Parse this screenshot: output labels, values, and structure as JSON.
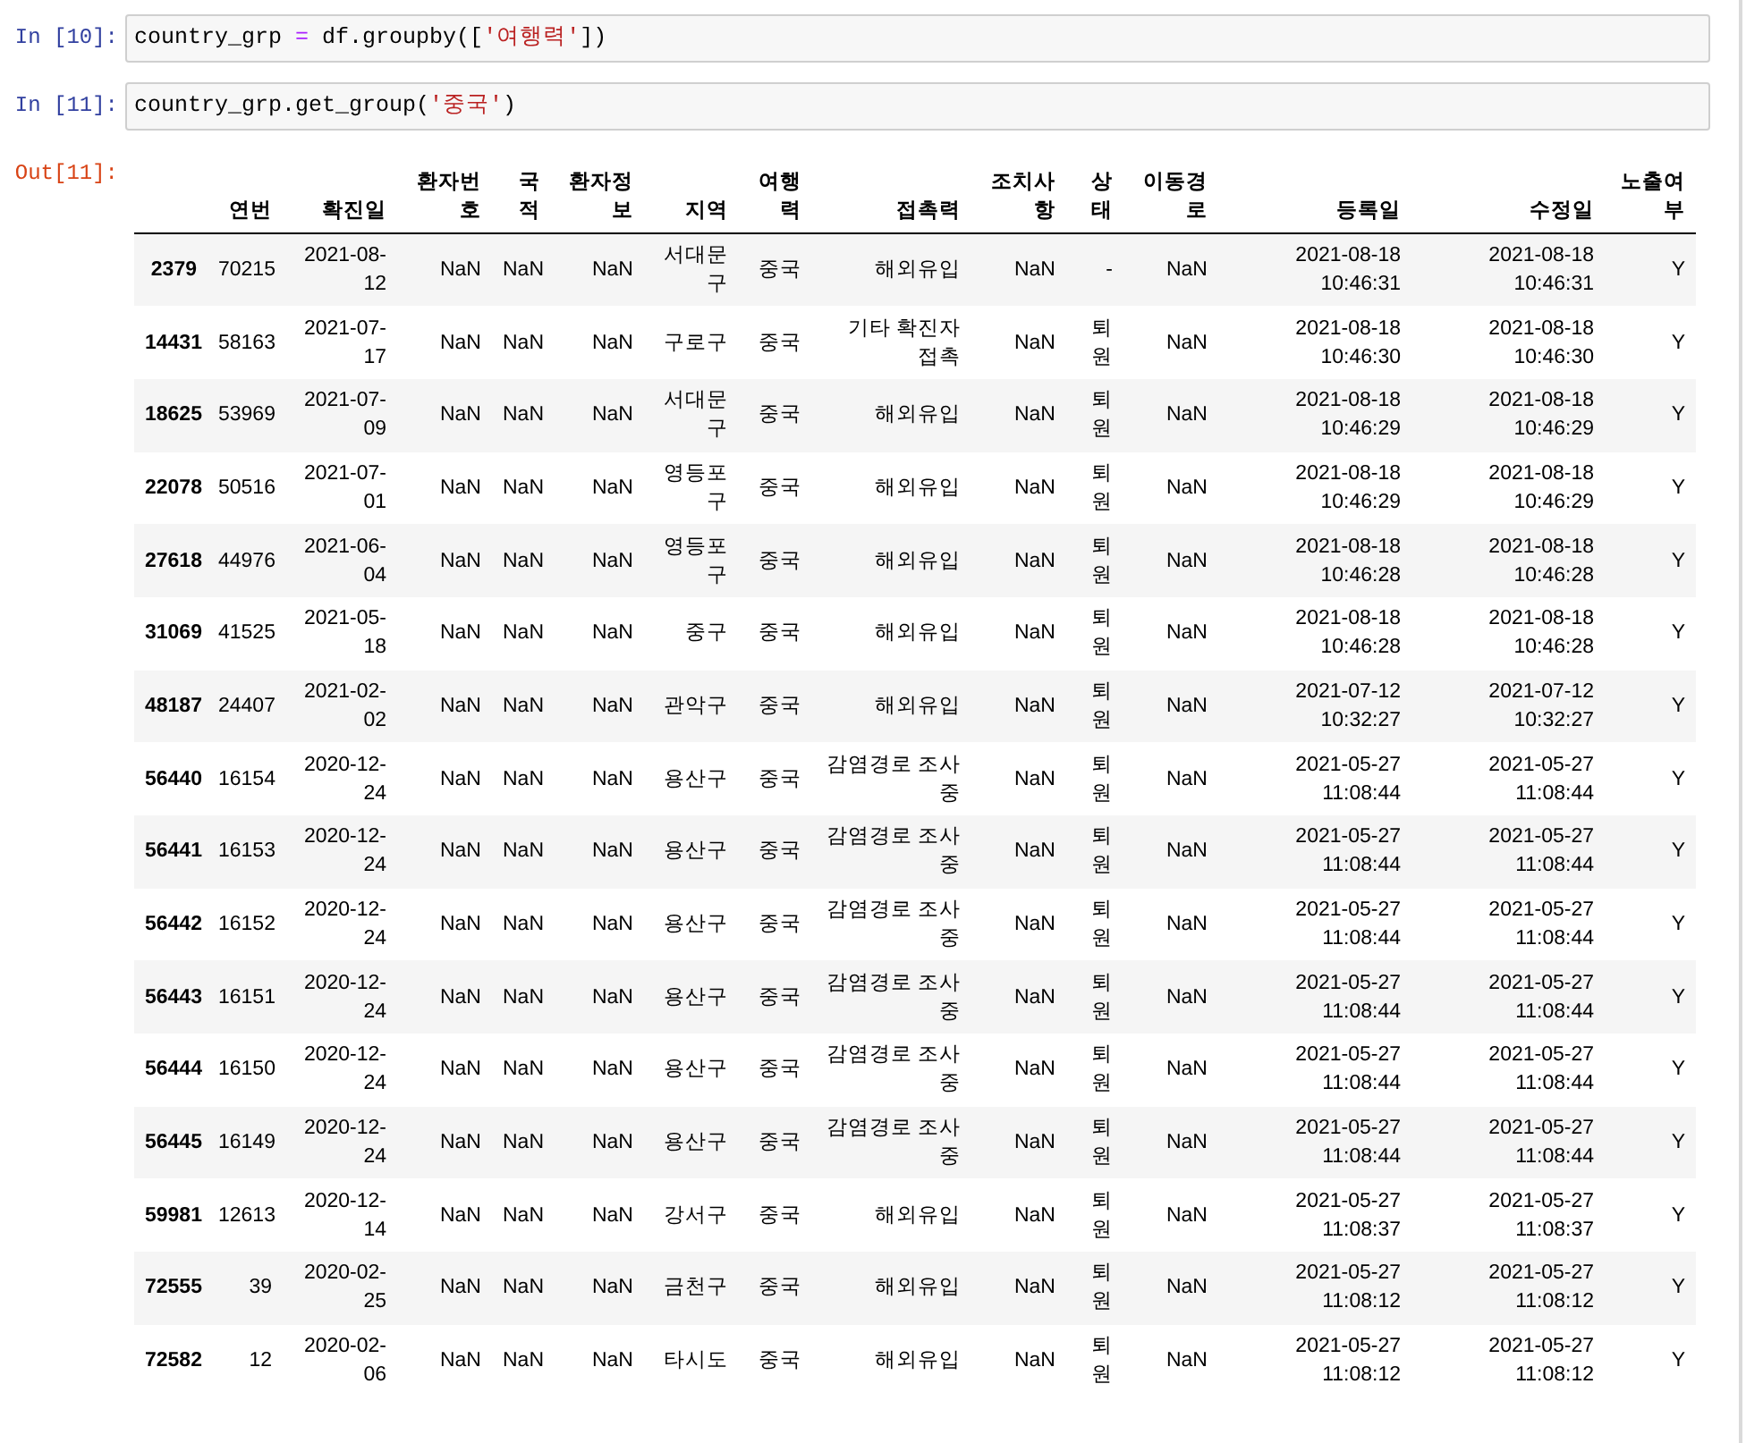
{
  "cells": [
    {
      "prompt": "In [10]:",
      "tokens": [
        {
          "text": "country_grp ",
          "kind": "name"
        },
        {
          "text": "=",
          "kind": "operator"
        },
        {
          "text": " df.groupby([",
          "kind": "name"
        },
        {
          "text": "'여행력'",
          "kind": "string"
        },
        {
          "text": "])",
          "kind": "name"
        }
      ]
    },
    {
      "prompt": "In [11]:",
      "tokens": [
        {
          "text": "country_grp.get_group(",
          "kind": "name"
        },
        {
          "text": "'중국'",
          "kind": "string"
        },
        {
          "text": ")",
          "kind": "name"
        }
      ]
    }
  ],
  "output": {
    "prompt": "Out[11]:",
    "table": {
      "columns": [
        "연번",
        "확진일",
        "환자번호",
        "국적",
        "환자정보",
        "지역",
        "여행력",
        "접촉력",
        "조치사항",
        "상태",
        "이동경로",
        "등록일",
        "수정일",
        "노출여부"
      ],
      "rows": [
        {
          "index": "2379",
          "cells": [
            "70215",
            "2021-08-12",
            "NaN",
            "NaN",
            "NaN",
            "서대문구",
            "중국",
            "해외유입",
            "NaN",
            "-",
            "NaN",
            "2021-08-18 10:46:31",
            "2021-08-18 10:46:31",
            "Y"
          ]
        },
        {
          "index": "14431",
          "cells": [
            "58163",
            "2021-07-17",
            "NaN",
            "NaN",
            "NaN",
            "구로구",
            "중국",
            "기타 확진자 접촉",
            "NaN",
            "퇴원",
            "NaN",
            "2021-08-18 10:46:30",
            "2021-08-18 10:46:30",
            "Y"
          ]
        },
        {
          "index": "18625",
          "cells": [
            "53969",
            "2021-07-09",
            "NaN",
            "NaN",
            "NaN",
            "서대문구",
            "중국",
            "해외유입",
            "NaN",
            "퇴원",
            "NaN",
            "2021-08-18 10:46:29",
            "2021-08-18 10:46:29",
            "Y"
          ]
        },
        {
          "index": "22078",
          "cells": [
            "50516",
            "2021-07-01",
            "NaN",
            "NaN",
            "NaN",
            "영등포구",
            "중국",
            "해외유입",
            "NaN",
            "퇴원",
            "NaN",
            "2021-08-18 10:46:29",
            "2021-08-18 10:46:29",
            "Y"
          ]
        },
        {
          "index": "27618",
          "cells": [
            "44976",
            "2021-06-04",
            "NaN",
            "NaN",
            "NaN",
            "영등포구",
            "중국",
            "해외유입",
            "NaN",
            "퇴원",
            "NaN",
            "2021-08-18 10:46:28",
            "2021-08-18 10:46:28",
            "Y"
          ]
        },
        {
          "index": "31069",
          "cells": [
            "41525",
            "2021-05-18",
            "NaN",
            "NaN",
            "NaN",
            "중구",
            "중국",
            "해외유입",
            "NaN",
            "퇴원",
            "NaN",
            "2021-08-18 10:46:28",
            "2021-08-18 10:46:28",
            "Y"
          ]
        },
        {
          "index": "48187",
          "cells": [
            "24407",
            "2021-02-02",
            "NaN",
            "NaN",
            "NaN",
            "관악구",
            "중국",
            "해외유입",
            "NaN",
            "퇴원",
            "NaN",
            "2021-07-12 10:32:27",
            "2021-07-12 10:32:27",
            "Y"
          ]
        },
        {
          "index": "56440",
          "cells": [
            "16154",
            "2020-12-24",
            "NaN",
            "NaN",
            "NaN",
            "용산구",
            "중국",
            "감염경로 조사중",
            "NaN",
            "퇴원",
            "NaN",
            "2021-05-27 11:08:44",
            "2021-05-27 11:08:44",
            "Y"
          ]
        },
        {
          "index": "56441",
          "cells": [
            "16153",
            "2020-12-24",
            "NaN",
            "NaN",
            "NaN",
            "용산구",
            "중국",
            "감염경로 조사중",
            "NaN",
            "퇴원",
            "NaN",
            "2021-05-27 11:08:44",
            "2021-05-27 11:08:44",
            "Y"
          ]
        },
        {
          "index": "56442",
          "cells": [
            "16152",
            "2020-12-24",
            "NaN",
            "NaN",
            "NaN",
            "용산구",
            "중국",
            "감염경로 조사중",
            "NaN",
            "퇴원",
            "NaN",
            "2021-05-27 11:08:44",
            "2021-05-27 11:08:44",
            "Y"
          ]
        },
        {
          "index": "56443",
          "cells": [
            "16151",
            "2020-12-24",
            "NaN",
            "NaN",
            "NaN",
            "용산구",
            "중국",
            "감염경로 조사중",
            "NaN",
            "퇴원",
            "NaN",
            "2021-05-27 11:08:44",
            "2021-05-27 11:08:44",
            "Y"
          ]
        },
        {
          "index": "56444",
          "cells": [
            "16150",
            "2020-12-24",
            "NaN",
            "NaN",
            "NaN",
            "용산구",
            "중국",
            "감염경로 조사중",
            "NaN",
            "퇴원",
            "NaN",
            "2021-05-27 11:08:44",
            "2021-05-27 11:08:44",
            "Y"
          ]
        },
        {
          "index": "56445",
          "cells": [
            "16149",
            "2020-12-24",
            "NaN",
            "NaN",
            "NaN",
            "용산구",
            "중국",
            "감염경로 조사중",
            "NaN",
            "퇴원",
            "NaN",
            "2021-05-27 11:08:44",
            "2021-05-27 11:08:44",
            "Y"
          ]
        },
        {
          "index": "59981",
          "cells": [
            "12613",
            "2020-12-14",
            "NaN",
            "NaN",
            "NaN",
            "강서구",
            "중국",
            "해외유입",
            "NaN",
            "퇴원",
            "NaN",
            "2021-05-27 11:08:37",
            "2021-05-27 11:08:37",
            "Y"
          ]
        },
        {
          "index": "72555",
          "cells": [
            "39",
            "2020-02-25",
            "NaN",
            "NaN",
            "NaN",
            "금천구",
            "중국",
            "해외유입",
            "NaN",
            "퇴원",
            "NaN",
            "2021-05-27 11:08:12",
            "2021-05-27 11:08:12",
            "Y"
          ]
        },
        {
          "index": "72582",
          "cells": [
            "12",
            "2020-02-06",
            "NaN",
            "NaN",
            "NaN",
            "타시도",
            "중국",
            "해외유입",
            "NaN",
            "퇴원",
            "NaN",
            "2021-05-27 11:08:12",
            "2021-05-27 11:08:12",
            "Y"
          ]
        }
      ]
    }
  }
}
